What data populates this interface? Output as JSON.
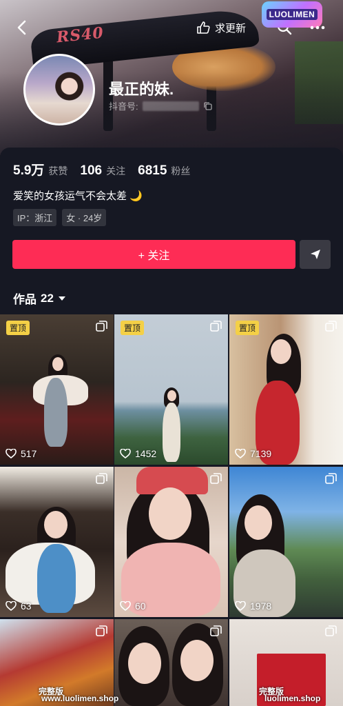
{
  "header": {
    "back_icon": "back-chevron-icon",
    "seek_update_label": "求更新",
    "seek_update_icon": "thumbs-up-hand-icon",
    "search_icon": "search-icon",
    "more_icon": "more-dots-icon",
    "cover_text": "RS40",
    "watermark_logo": "LUOLIMEN"
  },
  "profile": {
    "display_name": "最正的妹.",
    "douyin_id_label": "抖音号:",
    "avatar_icon": "avatar-photo"
  },
  "stats": [
    {
      "value": "5.9万",
      "label": "获赞"
    },
    {
      "value": "106",
      "label": "关注"
    },
    {
      "value": "6815",
      "label": "粉丝"
    }
  ],
  "bio": "爱笑的女孩运气不会太差",
  "bio_emoji": "🌙",
  "tags": [
    "IP：浙江",
    "女 · 24岁"
  ],
  "follow_button": "+ 关注",
  "share_icon": "send-arrow-icon",
  "works_tab": {
    "label": "作品",
    "count": "22"
  },
  "posts": [
    {
      "pinned": true,
      "pin_label": "置顶",
      "likes": "517"
    },
    {
      "pinned": true,
      "pin_label": "置顶",
      "likes": "1452"
    },
    {
      "pinned": true,
      "pin_label": "置顶",
      "likes": "7139"
    },
    {
      "pinned": false,
      "likes": "63"
    },
    {
      "pinned": false,
      "likes": "60"
    },
    {
      "pinned": false,
      "likes": "1978"
    },
    {
      "pinned": false,
      "likes": ""
    },
    {
      "pinned": false,
      "likes": ""
    },
    {
      "pinned": false,
      "likes": ""
    }
  ],
  "bottom_watermarks": {
    "left_badge": "完整版",
    "left_site": "www.luolimen.shop",
    "right_badge": "完整版",
    "right_site": "luolimen.shop"
  },
  "colors": {
    "accent": "#fe2c55",
    "pin": "#f4d046",
    "background": "#161823"
  }
}
